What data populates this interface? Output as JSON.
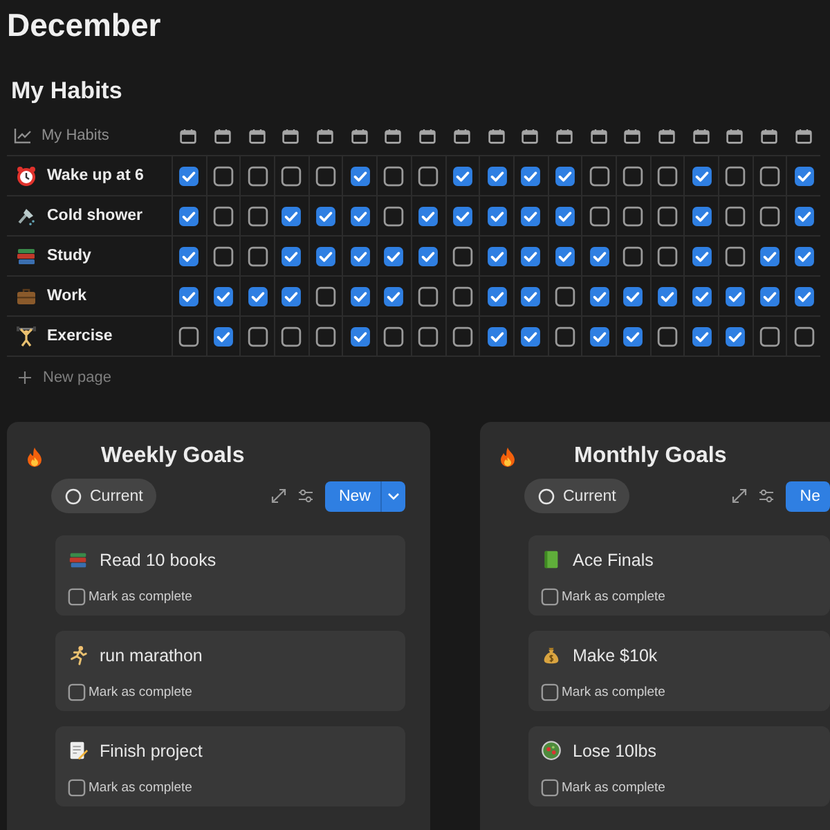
{
  "page": {
    "title": "December"
  },
  "habits": {
    "title": "My Habits",
    "header_label": "My Habits",
    "rows": [
      {
        "name": "Wake up at 6",
        "days": [
          {
            "checked": true
          },
          {
            "checked": false
          },
          {
            "checked": false
          },
          {
            "checked": false
          },
          {
            "checked": false
          },
          {
            "checked": true
          },
          {
            "checked": false
          },
          {
            "checked": false
          },
          {
            "checked": true
          },
          {
            "checked": true
          },
          {
            "checked": true
          },
          {
            "checked": true
          },
          {
            "checked": false
          },
          {
            "checked": false
          },
          {
            "checked": false
          },
          {
            "checked": true
          },
          {
            "checked": false
          },
          {
            "checked": false
          },
          {
            "checked": true
          }
        ]
      },
      {
        "name": "Cold shower",
        "days": [
          {
            "checked": true
          },
          {
            "checked": false
          },
          {
            "checked": false
          },
          {
            "checked": true
          },
          {
            "checked": true
          },
          {
            "checked": true
          },
          {
            "checked": false
          },
          {
            "checked": true
          },
          {
            "checked": true
          },
          {
            "checked": true
          },
          {
            "checked": true
          },
          {
            "checked": true
          },
          {
            "checked": false
          },
          {
            "checked": false
          },
          {
            "checked": false
          },
          {
            "checked": true
          },
          {
            "checked": false
          },
          {
            "checked": false
          },
          {
            "checked": true
          }
        ]
      },
      {
        "name": "Study",
        "days": [
          {
            "checked": true
          },
          {
            "checked": false
          },
          {
            "checked": false
          },
          {
            "checked": true
          },
          {
            "checked": true
          },
          {
            "checked": true
          },
          {
            "checked": true
          },
          {
            "checked": true
          },
          {
            "checked": false
          },
          {
            "checked": true
          },
          {
            "checked": true
          },
          {
            "checked": true
          },
          {
            "checked": true
          },
          {
            "checked": false
          },
          {
            "checked": false
          },
          {
            "checked": true
          },
          {
            "checked": false
          },
          {
            "checked": true
          },
          {
            "checked": true
          }
        ]
      },
      {
        "name": "Work",
        "days": [
          {
            "checked": true
          },
          {
            "checked": true
          },
          {
            "checked": true
          },
          {
            "checked": true
          },
          {
            "checked": false
          },
          {
            "checked": true
          },
          {
            "checked": true
          },
          {
            "checked": false
          },
          {
            "checked": false
          },
          {
            "checked": true
          },
          {
            "checked": true
          },
          {
            "checked": false
          },
          {
            "checked": true
          },
          {
            "checked": true
          },
          {
            "checked": true
          },
          {
            "checked": true
          },
          {
            "checked": true
          },
          {
            "checked": true
          },
          {
            "checked": true
          }
        ]
      },
      {
        "name": "Exercise",
        "days": [
          {
            "checked": false
          },
          {
            "checked": true
          },
          {
            "checked": false
          },
          {
            "checked": false
          },
          {
            "checked": false
          },
          {
            "checked": true
          },
          {
            "checked": false
          },
          {
            "checked": false
          },
          {
            "checked": false
          },
          {
            "checked": true
          },
          {
            "checked": true
          },
          {
            "checked": false
          },
          {
            "checked": true
          },
          {
            "checked": true
          },
          {
            "checked": false
          },
          {
            "checked": true
          },
          {
            "checked": true
          },
          {
            "checked": false
          },
          {
            "checked": false
          }
        ]
      }
    ],
    "new_page": "New page"
  },
  "boards": [
    {
      "title": "Weekly Goals",
      "filter": "Current",
      "new_button": "New",
      "goals": [
        {
          "title": "Read 10 books",
          "complete_label": "Mark as complete",
          "checked": false
        },
        {
          "title": "run marathon",
          "complete_label": "Mark as complete",
          "checked": false
        },
        {
          "title": "Finish project",
          "complete_label": "Mark as complete",
          "checked": false
        }
      ]
    },
    {
      "title": "Monthly Goals",
      "filter": "Current",
      "new_button": "Ne",
      "goals": [
        {
          "title": "Ace Finals",
          "complete_label": "Mark as complete",
          "checked": false
        },
        {
          "title": "Make $10k",
          "complete_label": "Mark as complete",
          "checked": false
        },
        {
          "title": "Lose 10lbs",
          "complete_label": "Mark as complete",
          "checked": false
        }
      ]
    }
  ]
}
